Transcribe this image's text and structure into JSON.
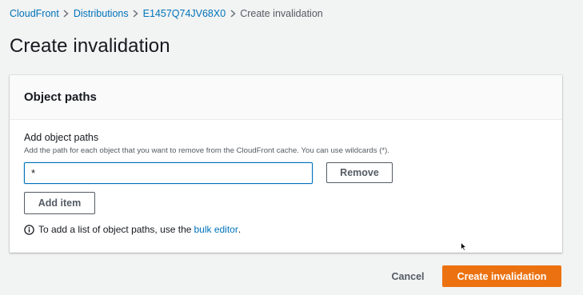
{
  "breadcrumb": {
    "items": [
      {
        "label": "CloudFront"
      },
      {
        "label": "Distributions"
      },
      {
        "label": "E1457Q74JV68X0"
      }
    ],
    "current": "Create invalidation",
    "separator_icon": "chevron-right-icon"
  },
  "page": {
    "title": "Create invalidation"
  },
  "panel": {
    "title": "Object paths",
    "field_label": "Add object paths",
    "field_description": "Add the path for each object that you want to remove from the CloudFront cache. You can use wildcards (*).",
    "path_input_value": "*",
    "remove_label": "Remove",
    "add_item_label": "Add item",
    "info": {
      "icon": "info-icon",
      "text_before": "To add a list of object paths, use the",
      "link_text": "bulk editor",
      "text_after": "."
    }
  },
  "footer": {
    "cancel_label": "Cancel",
    "create_label": "Create invalidation"
  },
  "colors": {
    "link": "#0073bb",
    "primary": "#ec7211",
    "background": "#f2f3f3",
    "text": "#16191f",
    "muted": "#545b64"
  }
}
